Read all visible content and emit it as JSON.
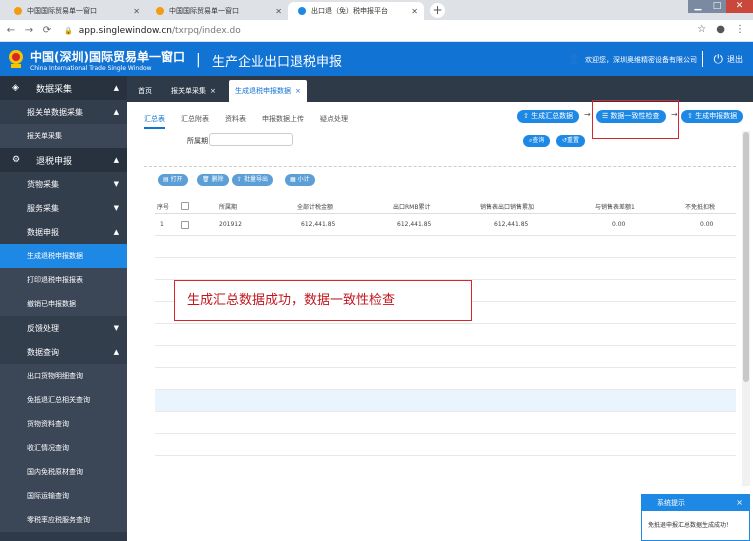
{
  "browser": {
    "tabs": [
      {
        "title": "中国国际贸易单一窗口"
      },
      {
        "title": "中国国际贸易单一窗口"
      },
      {
        "title": "出口退（免）税申报平台"
      }
    ],
    "url_host": "app.singlewindow.cn",
    "url_path": "/txrpq/index.do",
    "url_scheme_note": ""
  },
  "header": {
    "brand_cn": "中国(深圳)国际贸易单一窗口",
    "brand_en": "China International Trade Single Window",
    "divider": "|",
    "system_title": "生产企业出口退税申报",
    "welcome": "欢迎您，深圳奥维精密设备有限公司",
    "logout": "退出"
  },
  "sidebar": {
    "groups": [
      {
        "label": "数据采集",
        "icon": "layers-icon",
        "arrow": "▲"
      },
      {
        "label": "退税申报",
        "icon": "gear-icon",
        "arrow": "▲"
      }
    ],
    "items": [
      {
        "label": "报关单数据采集",
        "arrow": "▲"
      },
      {
        "label": "报关单采集"
      },
      {
        "label": "货物采集",
        "arrow": "▼"
      },
      {
        "label": "服务采集",
        "arrow": "▼"
      },
      {
        "label": "数据申报",
        "arrow": "▲"
      },
      {
        "label": "生成退税申报数据"
      },
      {
        "label": "打印退税申报报表"
      },
      {
        "label": "撤销已申报数据"
      },
      {
        "label": "反馈处理",
        "arrow": "▼"
      },
      {
        "label": "数据查询",
        "arrow": "▲"
      },
      {
        "label": "出口货物明细查询"
      },
      {
        "label": "免抵退汇总相关查询"
      },
      {
        "label": "货物资料查询"
      },
      {
        "label": "收汇情况查询"
      },
      {
        "label": "国内免税原材查询"
      },
      {
        "label": "国际运输查询"
      },
      {
        "label": "零税率应税服务查询"
      }
    ]
  },
  "page_tabs": [
    {
      "label": "首页"
    },
    {
      "label": "报关单采集"
    },
    {
      "label": "生成退税申报数据"
    }
  ],
  "tab_close": "×",
  "sub_tabs": [
    {
      "label": "汇总表"
    },
    {
      "label": "汇总附表"
    },
    {
      "label": "资料表"
    },
    {
      "label": "申报数据上传"
    },
    {
      "label": "疑点处理"
    }
  ],
  "filter": {
    "period_label": "所属期",
    "period_value": ""
  },
  "flow": {
    "gen_summary": "生成汇总数据",
    "consistency_check": "数据一致性检查",
    "gen_declaration": "生成申报数据"
  },
  "search": {
    "query": "查询",
    "reset": "重置"
  },
  "actions": {
    "open": "打开",
    "delete": "删除",
    "export": "批量导出",
    "subtotal": "小计"
  },
  "table": {
    "headers": [
      "序号",
      "所属期",
      "全部计税金额",
      "出口RMB累计",
      "销售表出口销售累加",
      "与销售表差额1",
      "不免抵扣税"
    ],
    "rows": [
      {
        "no": "1",
        "period": "201912",
        "total": "612,441.85",
        "rmb": "612,441.85",
        "sales": "612,441.85",
        "diff": "0.00",
        "nodeduct": "0.00"
      }
    ]
  },
  "annotation": "生成汇总数据成功，数据一致性检查",
  "toast": {
    "title": "系统提示",
    "message": "免抵退申报汇总数据生成成功！",
    "close": "×"
  },
  "colors": {
    "header": "#1173d4",
    "sidebar": "#2f3a48",
    "accent": "#1e88e5",
    "annotation": "#d9262c"
  }
}
